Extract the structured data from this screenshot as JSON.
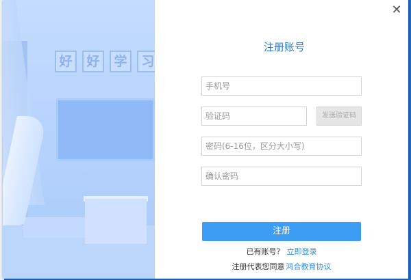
{
  "illustration": {
    "slogan": [
      "好",
      "好",
      "学",
      "习"
    ]
  },
  "dialog": {
    "title": "注册账号",
    "close_glyph": "✕"
  },
  "form": {
    "phone_placeholder": "手机号",
    "code_placeholder": "验证码",
    "send_code_label": "发送验证码",
    "password_placeholder": "密码(6-16位，区分大小写)",
    "confirm_placeholder": "确认密码",
    "submit_label": "注册"
  },
  "footer": {
    "have_account_text": "已有账号？",
    "login_link": "立即登录",
    "agree_text": "注册代表您同意",
    "agreement_link": "鸿合教育协议"
  },
  "colors": {
    "accent": "#3d9cf3",
    "title": "#2f77c4",
    "link": "#2f8ee6"
  }
}
